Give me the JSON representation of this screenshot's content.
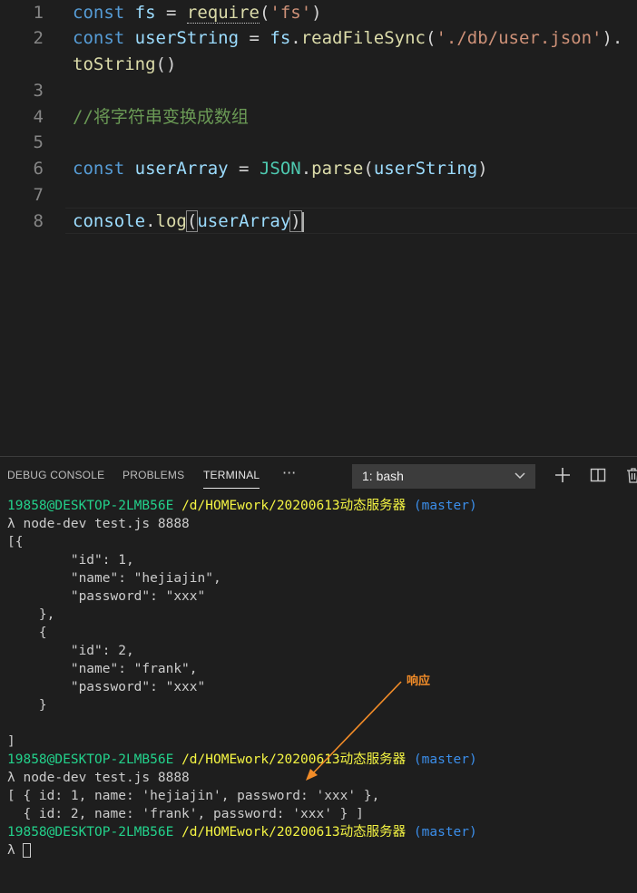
{
  "editor": {
    "line_numbers": [
      "1",
      "2",
      "",
      "3",
      "4",
      "5",
      "6",
      "7",
      "8"
    ],
    "line1": {
      "kw": "const",
      "var": "fs",
      "eq": " = ",
      "fn": "require",
      "open": "(",
      "str": "'fs'",
      "close": ")"
    },
    "line2": {
      "kw": "const",
      "var": "userString",
      "eq": " = ",
      "obj": "fs",
      "dot": ".",
      "fn": "readFileSync",
      "open": "(",
      "str": "'./db/user.json'",
      "close": ")."
    },
    "line2_wrap": {
      "fn": "toString",
      "paren": "()"
    },
    "line4": {
      "comment": "//将字符串变换成数组"
    },
    "line6": {
      "kw": "const",
      "var": "userArray",
      "eq": " = ",
      "cls": "JSON",
      "dot": ".",
      "fn": "parse",
      "open": "(",
      "arg": "userString",
      "close": ")"
    },
    "line8": {
      "obj": "console",
      "dot": ".",
      "fn": "log",
      "open": "(",
      "arg": "userArray",
      "close": ")"
    }
  },
  "panel": {
    "tabs": {
      "debug": "DEBUG CONSOLE",
      "problems": "PROBLEMS",
      "terminal": "TERMINAL",
      "more": "···"
    },
    "terminal_select": "1: bash",
    "icons": [
      "plus-icon",
      "split-icon",
      "trash-icon"
    ]
  },
  "terminal": {
    "prompt_user": "19858@DESKTOP-2LMB56E",
    "prompt_path": "/d/HOMEwork/20200613动态服务器",
    "prompt_branch": "(master)",
    "cmd": "λ node-dev test.js 8888",
    "lines1": [
      "[{",
      "        \"id\": 1,",
      "        \"name\": \"hejiajin\",",
      "        \"password\": \"xxx\"",
      "    },",
      "    {",
      "        \"id\": 2,",
      "        \"name\": \"frank\",",
      "        \"password\": \"xxx\"",
      "    }",
      "",
      "]"
    ],
    "lines2": [
      "[ { id: 1, name: 'hejiajin', password: 'xxx' },",
      "  { id: 2, name: 'frank', password: 'xxx' } ]"
    ],
    "final_prompt": "λ "
  },
  "annotation": {
    "text": "响应",
    "color": "#f28c28"
  }
}
